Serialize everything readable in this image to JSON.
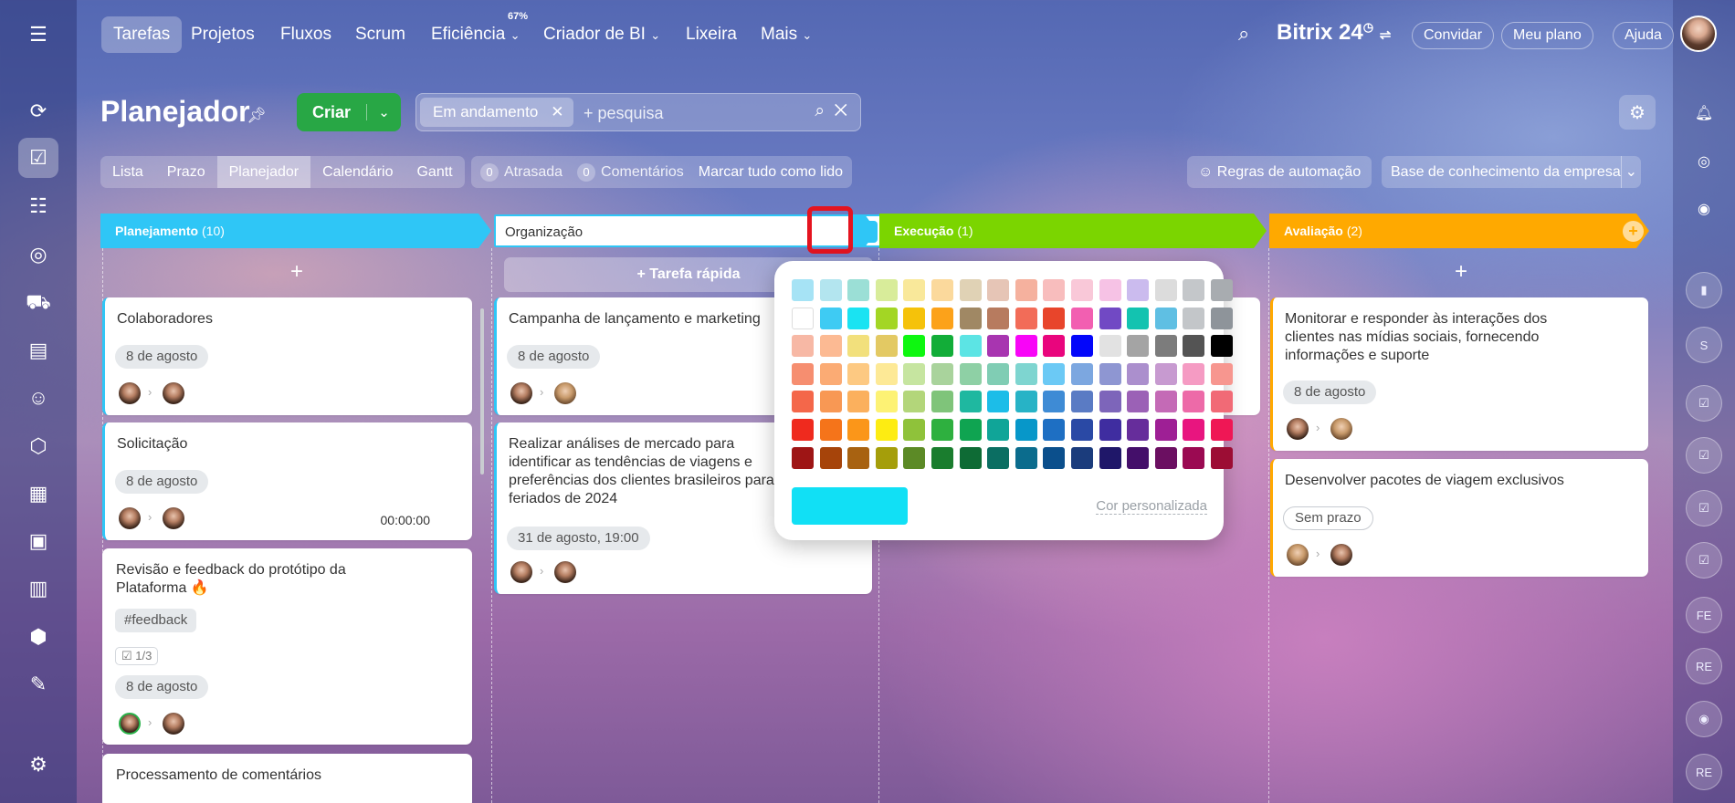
{
  "topnav": {
    "items": [
      "Tarefas",
      "Projetos",
      "Fluxos",
      "Scrum",
      "Eficiência",
      "Criador de BI",
      "Lixeira",
      "Mais"
    ],
    "efficiency_badge": "67%",
    "brand": "Bitrix",
    "brand_num": "24",
    "invite": "Convidar",
    "plan": "Meu plano",
    "help": "Ajuda"
  },
  "header": {
    "title": "Planejador",
    "create": "Criar",
    "filter_chip": "Em andamento",
    "search_placeholder": "+ pesquisa"
  },
  "views": {
    "tabs": [
      "Lista",
      "Prazo",
      "Planejador",
      "Calendário",
      "Gantt"
    ],
    "overdue_count": "0",
    "overdue_label": "Atrasada",
    "comments_count": "0",
    "comments_label": "Comentários",
    "mark_read": "Marcar tudo como lido",
    "automation": "Regras de automação",
    "knowledge_base": "Base de conhecimento da empresa"
  },
  "stages": {
    "planning": {
      "name": "Planejamento",
      "count": "(10)",
      "color": "#2fc6f6"
    },
    "organization": {
      "value": "Organização",
      "color": "#2fc6f6"
    },
    "execution": {
      "name": "Execução",
      "count": "(1)",
      "color": "#7bd500"
    },
    "evaluation": {
      "name": "Avaliação",
      "count": "(2)",
      "color": "#ffa900"
    }
  },
  "quick_task": "+ Tarefa rápida",
  "planning_cards": [
    {
      "title": "Colaboradores",
      "date": "8 de agosto"
    },
    {
      "title": "Solicitação",
      "date": "8 de agosto",
      "time": "00:00:00"
    },
    {
      "title": "Revisão e feedback do protótipo da Plataforma 🔥",
      "tag": "#feedback",
      "checklist": "1/3",
      "date": "8 de agosto"
    },
    {
      "title": "Processamento de comentários"
    }
  ],
  "organization_cards": [
    {
      "title": "Campanha de lançamento e marketing",
      "date": "8 de agosto"
    },
    {
      "title": "Realizar análises de mercado para identificar as tendências de viagens e preferências dos clientes brasileiros para feriados de 2024",
      "date": "31 de agosto, 19:00"
    }
  ],
  "evaluation_cards": [
    {
      "title": "Monitorar e responder às interações dos clientes nas mídias sociais, fornecendo informações e suporte",
      "date": "8 de agosto"
    },
    {
      "title": "Desenvolver pacotes de viagem exclusivos",
      "date": "Sem prazo"
    }
  ],
  "color_picker": {
    "custom_color": "Cor personalizada",
    "selected_color": "#11e0f5",
    "rows": [
      [
        "#a6e3f5",
        "#b3e5ef",
        "#9bdfd6",
        "#d8ec9a",
        "#f9e89a",
        "#fbd99c",
        "#e0d2b5",
        "#e6c5b6",
        "#f5b19e",
        "#f8bdbd",
        "#f9c8d8",
        "#f6c2e5",
        "#cbbbee",
        "#dcdcdc",
        "#c4c7ca",
        "#a8acb0"
      ],
      [
        "#ffffff",
        "#3ecbf3",
        "#1ae3f2",
        "#a3d624",
        "#f5c20a",
        "#fca21a",
        "#a08864",
        "#b77b5f",
        "#f26c58",
        "#e8452b",
        "#f25fb1",
        "#7149c4",
        "#13c3b0",
        "#5fbfe3",
        "#c3c6c9",
        "#8e949a"
      ],
      [
        "#f7b8a5",
        "#fcba93",
        "#f2e07c",
        "#e3c963",
        "#0ef710",
        "#12ad38",
        "#5ce4e4",
        "#a835b0",
        "#f805f7",
        "#e9057d",
        "#0306fa",
        "#e2e2e2",
        "#a4a4a4",
        "#7c7c7c",
        "#545454",
        "#000000"
      ],
      [
        "#f68e70",
        "#fbab74",
        "#fdc982",
        "#fde996",
        "#c6e5a0",
        "#a9d39c",
        "#8ed0a5",
        "#80cdb4",
        "#7ed5d0",
        "#6bc9f5",
        "#7ca7e0",
        "#8e96d2",
        "#ab8fcd",
        "#c79ad0",
        "#f59bc3",
        "#f7968f"
      ],
      [
        "#f4674a",
        "#f89854",
        "#fbb05d",
        "#fdf274",
        "#b3d67a",
        "#7fc47a",
        "#1fb8a0",
        "#1cbde8",
        "#27b3c6",
        "#3e8bd5",
        "#5a7bc4",
        "#7d65ba",
        "#9b61b6",
        "#c46ab6",
        "#ed6aa8",
        "#f16a76"
      ],
      [
        "#ef2a1e",
        "#f5741a",
        "#fb9619",
        "#fdec12",
        "#8fc23a",
        "#2eb03f",
        "#0fa451",
        "#10a598",
        "#0797c9",
        "#1e6fc3",
        "#2a49a5",
        "#3f2da0",
        "#662d9b",
        "#9e1f95",
        "#e8157f",
        "#ef1755"
      ],
      [
        "#9e1515",
        "#a6440a",
        "#a86211",
        "#a59e0a",
        "#5c8a26",
        "#1a7d2e",
        "#0e6b35",
        "#0b6e62",
        "#0b6c8d",
        "#0b4f8c",
        "#1b3c7c",
        "#1f1769",
        "#440f6a",
        "#6b0f61",
        "#9b0a52",
        "#9c0d34"
      ]
    ]
  }
}
